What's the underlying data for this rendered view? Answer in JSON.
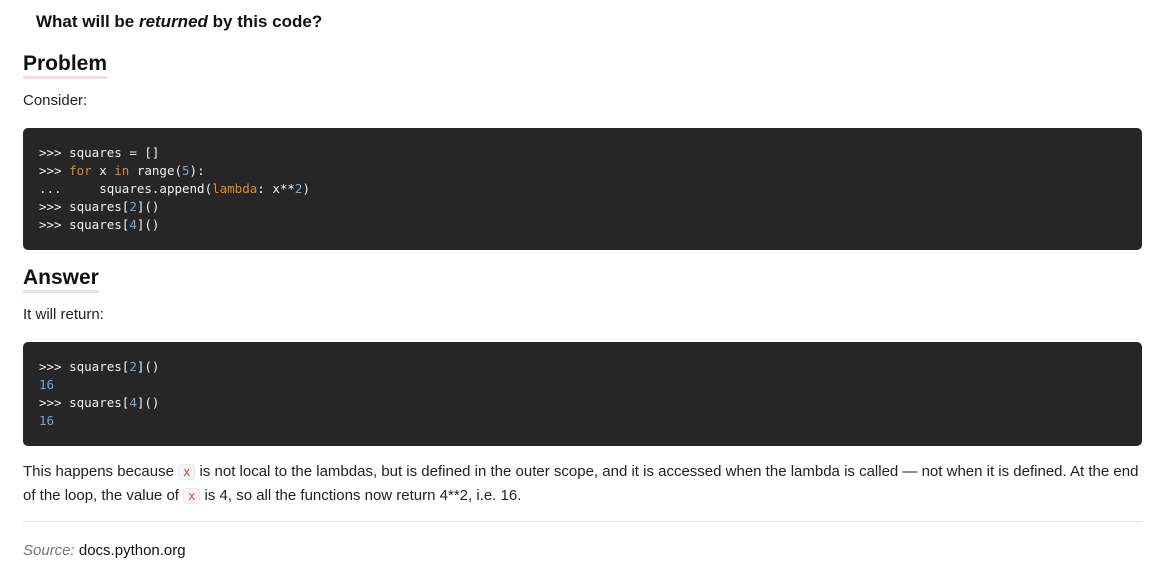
{
  "question": {
    "prefix": "What will be ",
    "emphasis": "returned",
    "suffix": " by this code?"
  },
  "problem": {
    "heading": "Problem",
    "intro": "Consider:",
    "code": {
      "l1_prompt": ">>> ",
      "l1_text": "squares = []",
      "l2_prompt": ">>> ",
      "l2_kw_for": "for",
      "l2_mid1": " x ",
      "l2_kw_in": "in",
      "l2_mid2": " range(",
      "l2_num": "5",
      "l2_end": "):",
      "l3_prompt": "...     ",
      "l3_text": "squares.append(",
      "l3_kw_lambda": "lambda",
      "l3_mid": ": x**",
      "l3_num": "2",
      "l3_end": ")",
      "l4_prompt": ">>> ",
      "l4_text": "squares[",
      "l4_num": "2",
      "l4_end": "]()",
      "l5_prompt": ">>> ",
      "l5_text": "squares[",
      "l5_num": "4",
      "l5_end": "]()"
    }
  },
  "answer": {
    "heading": "Answer",
    "intro": "It will return:",
    "code": {
      "l1_prompt": ">>> ",
      "l1_text": "squares[",
      "l1_num": "2",
      "l1_end": "]()",
      "l2_out": "16",
      "l3_prompt": ">>> ",
      "l3_text": "squares[",
      "l3_num": "4",
      "l3_end": "]()",
      "l4_out": "16"
    }
  },
  "explanation": {
    "part1": "This happens because ",
    "code1": "x",
    "part2": " is not local to the lambdas, but is defined in the outer scope, and it is accessed when the lambda is called — not when it is defined. At the end of the loop, the value of ",
    "code2": "x",
    "part3": " is 4, so all the functions now return 4**2, i.e. 16."
  },
  "source": {
    "label": "Source:",
    "link": "docs.python.org"
  }
}
